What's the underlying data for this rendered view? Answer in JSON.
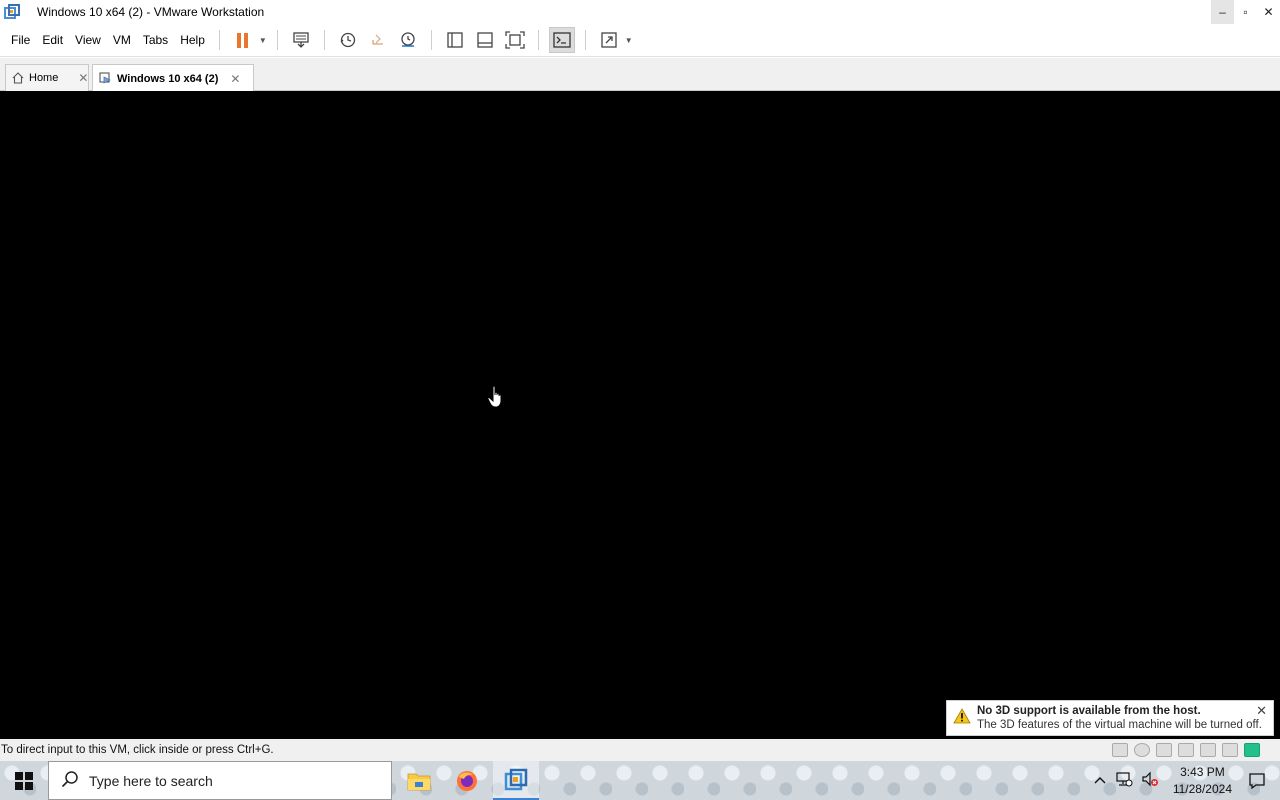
{
  "window": {
    "title": "Windows 10 x64 (2) - VMware Workstation",
    "minimize": "–",
    "maximize": "▫",
    "close": "✕"
  },
  "menu": [
    "File",
    "Edit",
    "View",
    "VM",
    "Tabs",
    "Help"
  ],
  "toolbar": {
    "icons": [
      "pause-icon",
      "send-ctrl-alt-del-icon",
      "snapshot-icon",
      "revert-snapshot-icon",
      "snapshot-manager-icon",
      "library-view-icon",
      "thumbnail-bar-icon",
      "full-screen-icon",
      "console-view-icon",
      "stretch-icon"
    ]
  },
  "tabs": [
    {
      "label": "Home",
      "active": false
    },
    {
      "label": "Windows 10 x64 (2)",
      "active": true
    }
  ],
  "notification": {
    "title": "No 3D support is available from the host.",
    "body": "The 3D features of the virtual machine will be turned off."
  },
  "status": {
    "text": "To direct input to this VM, click inside or press Ctrl+G."
  },
  "taskbar": {
    "search_placeholder": "Type here to search",
    "time": "3:43 PM",
    "date": "11/28/2024"
  },
  "colors": {
    "accent_orange": "#e8762b",
    "vm_background": "#000000",
    "status_green": "#24c08c"
  }
}
